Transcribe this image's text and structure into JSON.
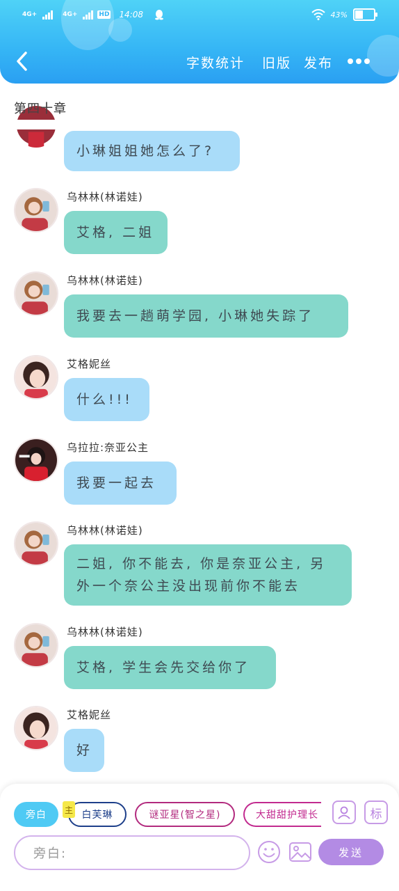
{
  "status_bar": {
    "network1": "4G+",
    "network2": "4G+",
    "hd": "HD",
    "time": "14:08",
    "battery_text": "43%",
    "battery_level": 0.43
  },
  "header": {
    "word_count": "字数统计",
    "old_version": "旧版",
    "publish": "发布"
  },
  "chapter_title": "第四十章",
  "messages": [
    {
      "name": "",
      "text": "小琳姐姐她怎么了?",
      "style": "blue"
    },
    {
      "name": "乌林林(林诺娃)",
      "text": "艾格, 二姐",
      "style": "green"
    },
    {
      "name": "乌林林(林诺娃)",
      "text": "我要去一趟萌学园, 小琳她失踪了",
      "style": "green"
    },
    {
      "name": "艾格妮丝",
      "text": "什么!!!",
      "style": "blue"
    },
    {
      "name": "乌拉拉:奈亚公主",
      "text": "我要一起去",
      "style": "blue"
    },
    {
      "name": "乌林林(林诺娃)",
      "text_lines": [
        "二姐, 你不能去, 你是奈亚公主, 另",
        "外一个奈公主没出现前你不能去"
      ],
      "style": "green"
    },
    {
      "name": "乌林林(林诺娃)",
      "text": "艾格, 学生会先交给你了",
      "style": "green"
    },
    {
      "name": "艾格妮丝",
      "text": "好",
      "style": "blue"
    }
  ],
  "roles": {
    "narration": "旁白",
    "main_badge": "主",
    "role1": "白芙琳",
    "role2": "谜亚星(智之星)",
    "role3": "大甜甜护理长"
  },
  "tools": {
    "person_icon": "person-card-icon",
    "mark_label": "标"
  },
  "input": {
    "placeholder": "旁白:"
  },
  "send_label": "发送",
  "colors": {
    "header_gradient_top": "#4fd2f7",
    "header_gradient_bottom": "#2a9ff2",
    "bubble_blue": "#a9dcf9",
    "bubble_green": "#85d8cb",
    "send": "#b38be4"
  }
}
